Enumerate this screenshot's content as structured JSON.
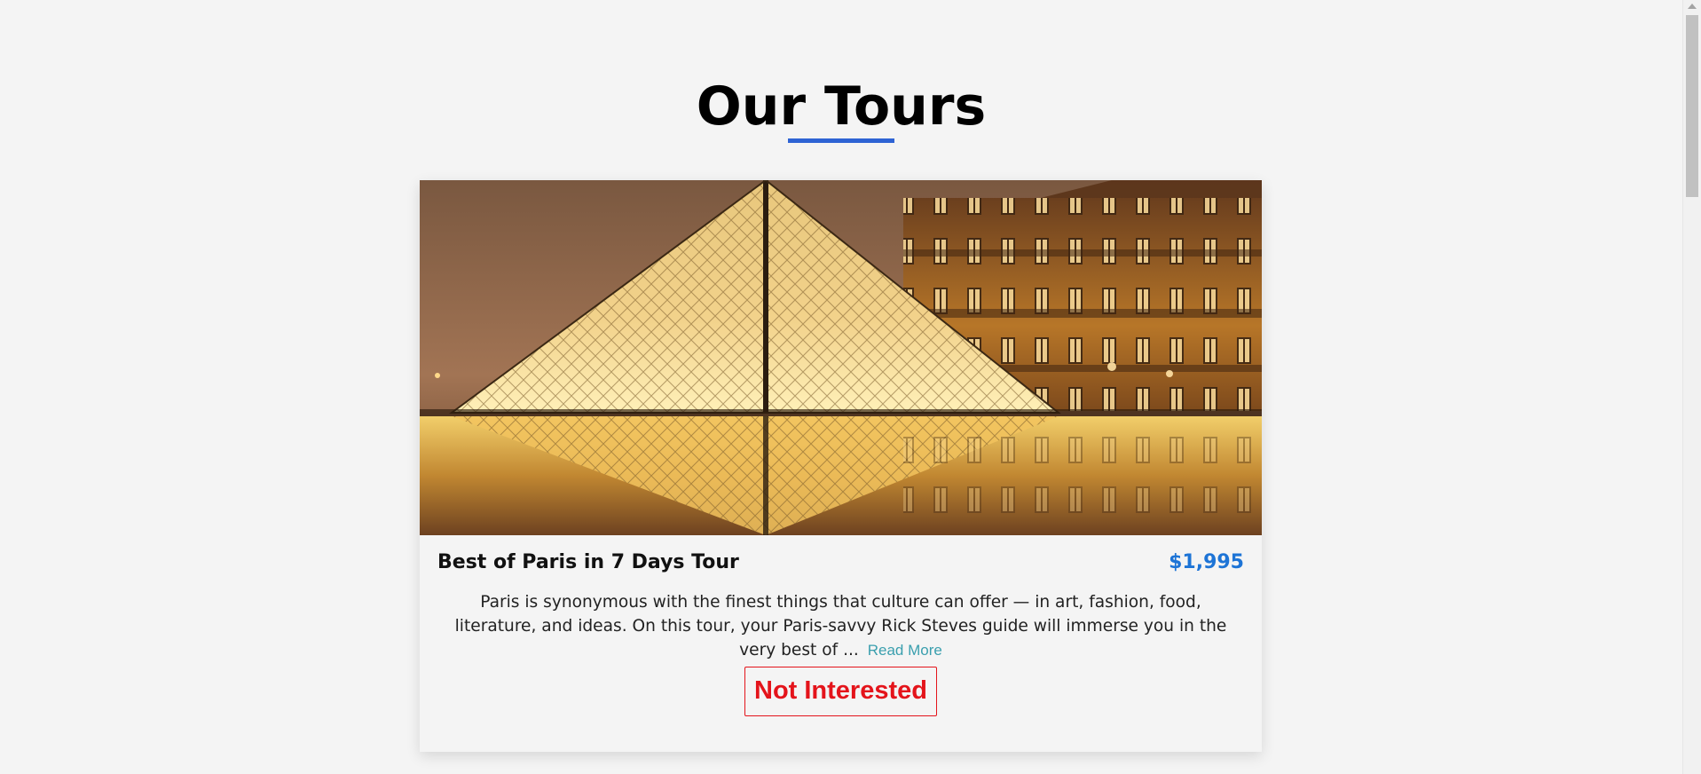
{
  "header": {
    "title": "Our Tours",
    "underline_color": "#2e63d4"
  },
  "tour": {
    "image_alt": "Louvre pyramid at night",
    "name": "Best of Paris in 7 Days Tour",
    "price": "$1,995",
    "description": "Paris is synonymous with the finest things that culture can offer — in art, fashion, food, literature, and ideas. On this tour, your Paris-savvy Rick Steves guide will immerse you in the very best of ...",
    "read_more_label": "Read More",
    "not_interested_label": "Not Interested"
  },
  "colors": {
    "background": "#f4f4f4",
    "price": "#1d74d6",
    "read_more": "#3a9fae",
    "not_interested": "#e4141b"
  },
  "icons": {
    "scroll_up": "triangle-up"
  }
}
